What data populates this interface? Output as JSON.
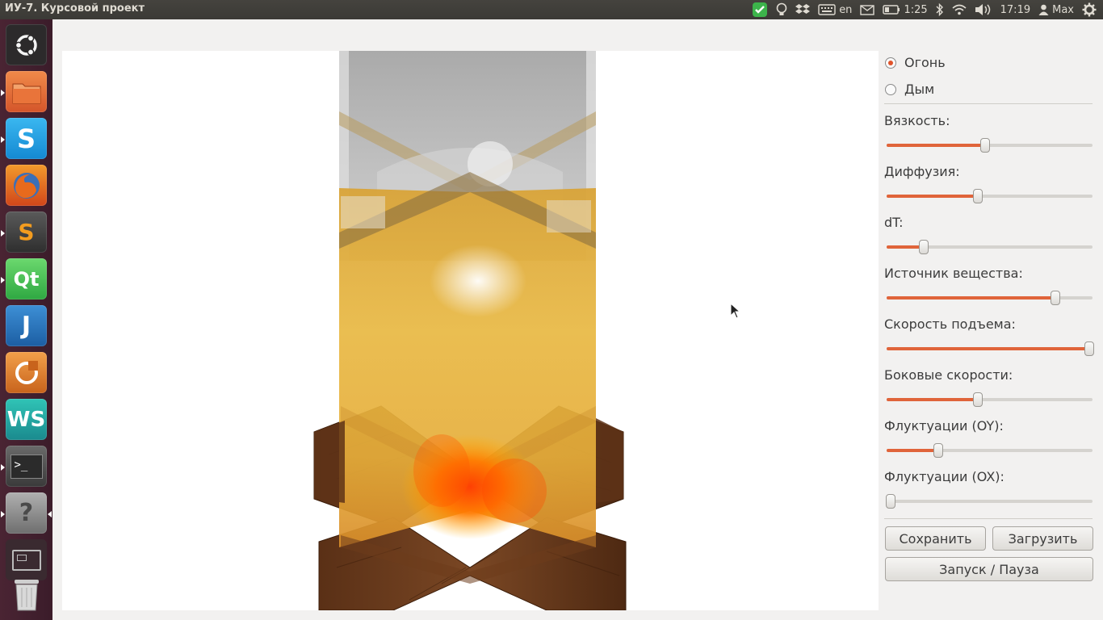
{
  "window": {
    "title": "ИУ-7. Курсовой проект"
  },
  "tray": {
    "keyboard_layout": "en",
    "battery_time": "1:25",
    "clock": "17:19",
    "user": "Max",
    "icons": [
      "check-shield-icon",
      "lightbulb-icon",
      "dropbox-icon",
      "keyboard-icon",
      "mail-icon",
      "battery-icon",
      "bluetooth-icon",
      "wifi-icon",
      "volume-icon",
      "user-icon",
      "gear-icon"
    ]
  },
  "launcher": {
    "items": [
      {
        "name": "ubuntu-dash-icon",
        "color": "#2a2a2a"
      },
      {
        "name": "files-icon",
        "color": "#e06a2c"
      },
      {
        "name": "skype-icon",
        "color": "#1aa3e8"
      },
      {
        "name": "firefox-icon",
        "color": "#d85c1b"
      },
      {
        "name": "sublime-text-icon",
        "color": "#4a4a4a"
      },
      {
        "name": "qt-creator-icon",
        "color": "#41cd52"
      },
      {
        "name": "intellij-icon",
        "color": "#2d7ec4"
      },
      {
        "name": "sts-icon",
        "color": "#e07b26"
      },
      {
        "name": "webstorm-icon",
        "color": "#1ba39a"
      },
      {
        "name": "terminal-icon",
        "color": "#333333"
      },
      {
        "name": "unknown-app-icon",
        "color": "#8a8a8a"
      },
      {
        "name": "workspace-switcher-icon",
        "color": "#3a2a30"
      },
      {
        "name": "trash-icon",
        "color": "#6a6a6a"
      }
    ]
  },
  "controls": {
    "mode": {
      "options": [
        {
          "label": "Огонь",
          "selected": true
        },
        {
          "label": "Дым",
          "selected": false
        }
      ]
    },
    "sliders": [
      {
        "label": "Вязкость:",
        "value": 0.48
      },
      {
        "label": "Диффузия:",
        "value": 0.445
      },
      {
        "label": "dT:",
        "value": 0.18
      },
      {
        "label": "Источник вещества:",
        "value": 0.82
      },
      {
        "label": "Скорость подъема:",
        "value": 0.985
      },
      {
        "label": "Боковые скорости:",
        "value": 0.445
      },
      {
        "label": "Флуктуации (OY):",
        "value": 0.25
      },
      {
        "label": "Флуктуации (OX):",
        "value": 0.02
      }
    ],
    "buttons": {
      "save": "Сохранить",
      "load": "Загрузить",
      "run": "Запуск / Пауза"
    }
  },
  "colors": {
    "accent": "#e0643a",
    "wood": "#6b3d1e",
    "flame_core": "#ff6a00",
    "smoke": "#b8b8b8"
  }
}
